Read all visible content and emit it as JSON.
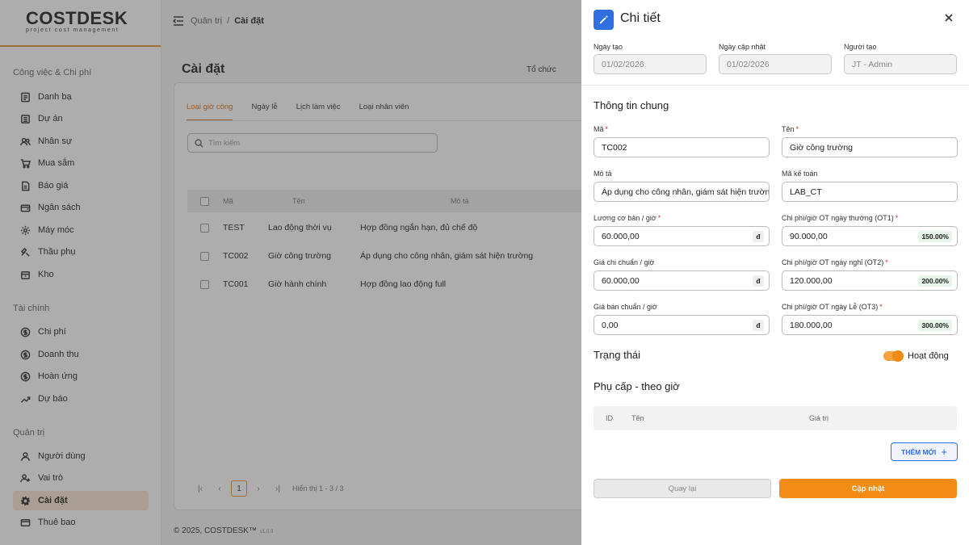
{
  "brand": {
    "name_a": "COST",
    "name_b": "DESK",
    "tagline": "project cost management"
  },
  "sidebar": {
    "sections": [
      {
        "title": "Công việc & Chi phí"
      },
      {
        "title": "Tài chính"
      },
      {
        "title": "Quản trị"
      }
    ],
    "items": [
      {
        "label": "Danh bạ",
        "icon": "contacts-icon"
      },
      {
        "label": "Dự án",
        "icon": "project-icon"
      },
      {
        "label": "Nhân sự",
        "icon": "users-icon"
      },
      {
        "label": "Mua sắm",
        "icon": "cart-icon"
      },
      {
        "label": "Báo giá",
        "icon": "quote-icon"
      },
      {
        "label": "Ngân sách",
        "icon": "wallet-icon"
      },
      {
        "label": "Máy móc",
        "icon": "machine-icon"
      },
      {
        "label": "Thầu phụ",
        "icon": "subcontractor-icon"
      },
      {
        "label": "Kho",
        "icon": "warehouse-icon"
      },
      {
        "label": "Chi phí",
        "icon": "cost-icon"
      },
      {
        "label": "Doanh thu",
        "icon": "revenue-icon"
      },
      {
        "label": "Hoàn ứng",
        "icon": "refund-icon"
      },
      {
        "label": "Dự báo",
        "icon": "forecast-icon"
      },
      {
        "label": "Người dùng",
        "icon": "user-icon"
      },
      {
        "label": "Vai trò",
        "icon": "role-icon"
      },
      {
        "label": "Cài đặt",
        "icon": "gear-icon"
      },
      {
        "label": "Thuê bao",
        "icon": "subscription-icon"
      }
    ]
  },
  "breadcrumb": {
    "parent": "Quản trị",
    "sep": "/",
    "current": "Cài đặt"
  },
  "page": {
    "title": "Cài đặt",
    "org_link": "Tổ chức"
  },
  "tabs": [
    "Loại giờ công",
    "Ngày lễ",
    "Lịch làm việc",
    "Loại nhân viên"
  ],
  "search": {
    "placeholder": "Tìm kiếm"
  },
  "table": {
    "headers": {
      "ma": "Mã",
      "ten": "Tên",
      "mota": "Mô tả"
    },
    "rows": [
      {
        "ma": "TEST",
        "ten": "Lao động thời vụ",
        "mota": "Hợp đồng ngắn hạn, đủ chế độ"
      },
      {
        "ma": "TC002",
        "ten": "Giờ công trường",
        "mota": "Áp dụng cho công nhân, giám sát hiện trường"
      },
      {
        "ma": "TC001",
        "ten": "Giờ hành chính",
        "mota": "Hợp đồng lao động full"
      }
    ]
  },
  "pagination": {
    "first": "|‹",
    "prev": "‹",
    "page": "1",
    "next": "›",
    "last": "›|",
    "summary": "Hiển thị 1 - 3 / 3"
  },
  "footer": {
    "text": "© 2025, COSTDESK™",
    "version": "v1.0.0"
  },
  "drawer": {
    "title": "Chi tiết",
    "created_label": "Ngày tạo",
    "created": "01/02/2026",
    "updated_label": "Ngày cập nhật",
    "updated": "01/02/2026",
    "creator_label": "Người tạo",
    "creator": "JT - Admin",
    "general_title": "Thông tin chung",
    "ma_label": "Mã",
    "ma": "TC002",
    "ten_label": "Tên",
    "ten": "Giờ công trường",
    "mota_label": "Mô tả",
    "mota": "Áp dụng cho công nhân, giám sát hiện trường",
    "mkt_label": "Mã kế toán",
    "mkt": "LAB_CT",
    "luong_label": "Lương cơ bản / giờ",
    "luong": "60.000,00",
    "currency": "đ",
    "ot1_label": "Chi phí/giờ OT ngày thường (OT1)",
    "ot1": "90.000,00",
    "ot1_pct": "150.00%",
    "chi_label": "Giá chi chuẩn / giờ",
    "chi": "60.000,00",
    "ot2_label": "Chi phí/giờ OT ngày nghỉ (OT2)",
    "ot2": "120.000,00",
    "ot2_pct": "200.00%",
    "ban_label": "Giá bán chuẩn / giờ",
    "ban": "0,00",
    "ot3_label": "Chi phí/giờ OT ngày Lễ (OT3)",
    "ot3": "180.000,00",
    "ot3_pct": "300.00%",
    "status_title": "Trạng thái",
    "status": "Hoạt động",
    "status_on": true,
    "allowance_title": "Phụ cấp - theo giờ",
    "allowance_headers": {
      "id": "ID",
      "ten": "Tên",
      "value": "Giá trị"
    },
    "add_label": "THÊM MỚI",
    "back_label": "Quay lại",
    "save_label": "Cập nhật"
  },
  "colors": {
    "accent": "#f28c16",
    "primary": "#2f6fe0",
    "required": "#d32f2f"
  }
}
